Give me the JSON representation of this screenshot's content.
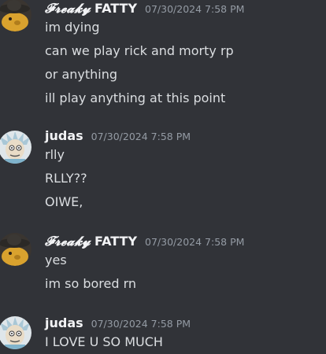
{
  "colors": {
    "background": "#313338",
    "username": "#f2f3f5",
    "timestamp": "#949ba4",
    "message_text": "#dbdee1"
  },
  "groups": [
    {
      "user_fancy": "𝓕𝓻𝓮𝓪𝓴𝔂",
      "user_plain": "FATTY",
      "timestamp": "07/30/2024 7:58 PM",
      "avatar_icon": "sombrero-dog-avatar",
      "messages": [
        "im dying",
        "can we play rick and morty rp",
        "or anything",
        "ill play anything at this point"
      ]
    },
    {
      "user": "judas",
      "timestamp": "07/30/2024 7:58 PM",
      "avatar_icon": "rick-sanchez-avatar",
      "messages": [
        "rlly",
        "RLLY??",
        "OIWE,"
      ]
    },
    {
      "user_fancy": "𝓕𝓻𝓮𝓪𝓴𝔂",
      "user_plain": "FATTY",
      "timestamp": "07/30/2024 7:58 PM",
      "avatar_icon": "sombrero-dog-avatar",
      "messages": [
        "yes",
        "im so bored rn"
      ]
    },
    {
      "user": "judas",
      "timestamp": "07/30/2024 7:58 PM",
      "avatar_icon": "rick-sanchez-avatar",
      "messages": [
        "I LOVE U SO MUCH"
      ]
    }
  ]
}
